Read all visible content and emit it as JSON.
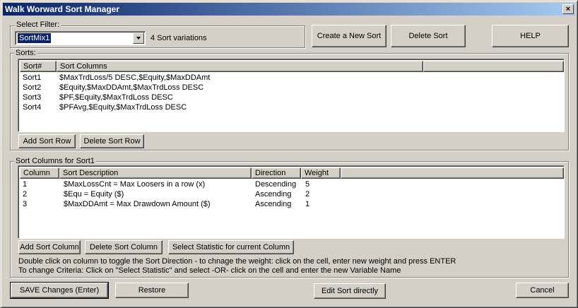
{
  "window": {
    "title": "Walk Worward Sort  Manager",
    "close_label": "×"
  },
  "filter": {
    "group_label": "Select Filter:",
    "selected": "SortMix1",
    "count_text": "4 Sort variations"
  },
  "top_buttons": {
    "create": "Create a New Sort",
    "delete": "Delete Sort",
    "help": "HELP"
  },
  "sorts": {
    "group_label": "Sorts:",
    "headers": [
      "Sort#",
      "Sort Columns",
      ""
    ],
    "rows": [
      {
        "id": "Sort1",
        "columns": "$MaxTrdLoss/5 DESC,$Equity,$MaxDDAmt"
      },
      {
        "id": "Sort2",
        "columns": "$Equity,$MaxDDAmt,$MaxTrdLoss DESC"
      },
      {
        "id": "Sort3",
        "columns": "$PF,$Equity,$MaxTrdLoss DESC"
      },
      {
        "id": "Sort4",
        "columns": "$PFAvg,$Equity,$MaxTrdLoss DESC"
      }
    ],
    "add_row": "Add Sort Row",
    "delete_row": "Delete Sort Row"
  },
  "sort_columns": {
    "group_label": "Sort Columns for Sort1",
    "headers": [
      "Column",
      "Sort Description",
      "Direction",
      "Weight",
      ""
    ],
    "rows": [
      {
        "col": "1",
        "desc": "$MaxLossCnt = Max Loosers in a row (x)",
        "dir": "Descending",
        "weight": "5"
      },
      {
        "col": "2",
        "desc": "$Equ = Equity ($)",
        "dir": "Ascending",
        "weight": "2"
      },
      {
        "col": "3",
        "desc": "$MaxDDAmt = Max Drawdown Amount ($)",
        "dir": "Ascending",
        "weight": "1"
      }
    ],
    "add_col": "Add Sort Column",
    "delete_col": "Delete Sort Column",
    "select_stat": "Select Statistic for current Column",
    "help_line1": "Double click on column to toggle the Sort Direction - to chnage the weight: click on the cell, enter new weight and press ENTER",
    "help_line2": "To change Criteria: Click on \"Select Statistic\" and select -OR- click on the cell and enter the new Variable Name"
  },
  "bottom_buttons": {
    "save": "SAVE Changes (Enter)",
    "restore": "Restore",
    "edit": "Edit Sort directly",
    "cancel": "Cancel"
  }
}
